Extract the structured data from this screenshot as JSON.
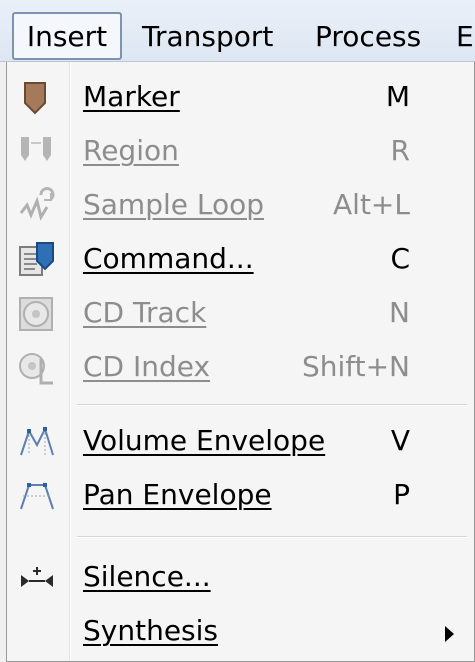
{
  "menubar": {
    "items": [
      {
        "label": "Insert"
      },
      {
        "label": "Transport"
      },
      {
        "label": "Process"
      },
      {
        "label": "E"
      }
    ]
  },
  "menu": {
    "items": [
      {
        "label": "Marker",
        "shortcut": "M",
        "enabled": true,
        "icon": "marker-icon"
      },
      {
        "label": "Region",
        "shortcut": "R",
        "enabled": false,
        "icon": "region-icon"
      },
      {
        "label": "Sample Loop",
        "shortcut": "Alt+L",
        "enabled": false,
        "icon": "sample-loop-icon"
      },
      {
        "label": "Command...",
        "shortcut": "C",
        "enabled": true,
        "icon": "command-icon"
      },
      {
        "label": "CD Track",
        "shortcut": "N",
        "enabled": false,
        "icon": "cd-track-icon"
      },
      {
        "label": "CD Index",
        "shortcut": "Shift+N",
        "enabled": false,
        "icon": "cd-index-icon"
      },
      {
        "label": "Volume Envelope",
        "shortcut": "V",
        "enabled": true,
        "icon": "volume-envelope-icon"
      },
      {
        "label": "Pan Envelope",
        "shortcut": "P",
        "enabled": true,
        "icon": "pan-envelope-icon"
      },
      {
        "label": "Silence...",
        "shortcut": "",
        "enabled": true,
        "icon": "silence-icon"
      },
      {
        "label": "Synthesis",
        "shortcut": "",
        "enabled": true,
        "icon": "",
        "submenu": true
      }
    ]
  }
}
